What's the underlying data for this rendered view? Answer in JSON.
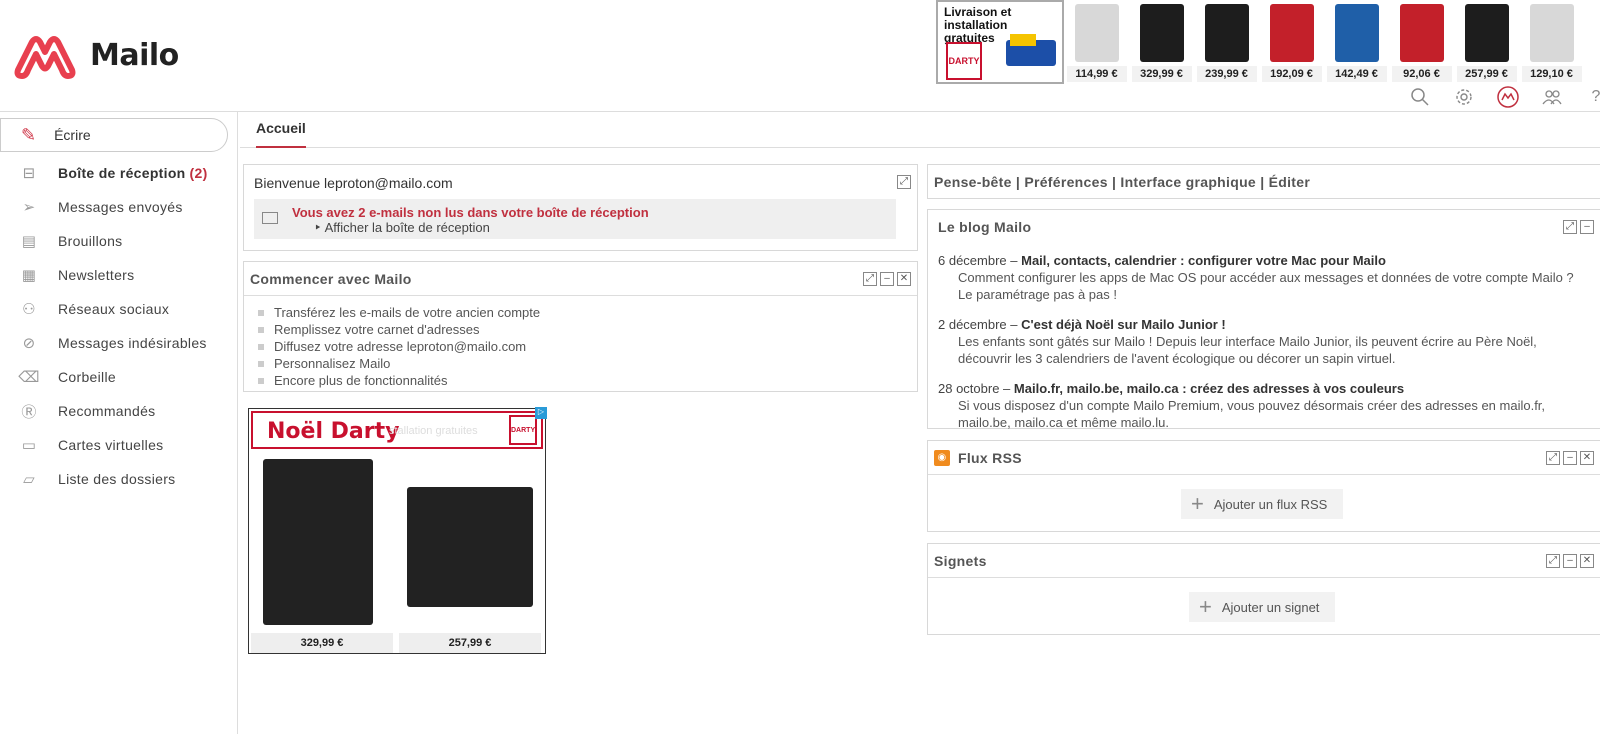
{
  "app": {
    "name": "Mailo"
  },
  "ad_banner": {
    "promo_title": "Livraison et installation gratuites",
    "promo_brand": "DARTY",
    "products": [
      {
        "price": "114,99 €",
        "color": "#d8d8d8"
      },
      {
        "price": "329,99 €",
        "color": "#1d1d1d"
      },
      {
        "price": "239,99 €",
        "color": "#1d1d1d"
      },
      {
        "price": "192,09 €",
        "color": "#c3202a"
      },
      {
        "price": "142,49 €",
        "color": "#1f5fa8"
      },
      {
        "price": "92,06 €",
        "color": "#c3202a"
      },
      {
        "price": "257,99 €",
        "color": "#1d1d1d"
      },
      {
        "price": "129,10 €",
        "color": "#d8d8d8"
      }
    ]
  },
  "top_icons": [
    "search-icon",
    "gear-icon",
    "mailo-icon",
    "contacts-icon",
    "help-icon"
  ],
  "sidebar": {
    "compose_label": "Écrire",
    "items": [
      {
        "label": "Boîte de réception",
        "count": "(2)",
        "icon": "inbox-icon"
      },
      {
        "label": "Messages envoyés",
        "icon": "send-icon"
      },
      {
        "label": "Brouillons",
        "icon": "draft-icon"
      },
      {
        "label": "Newsletters",
        "icon": "newsletter-icon"
      },
      {
        "label": "Réseaux sociaux",
        "icon": "social-icon"
      },
      {
        "label": "Messages indésirables",
        "icon": "spam-icon"
      },
      {
        "label": "Corbeille",
        "icon": "trash-icon"
      },
      {
        "label": "Recommandés",
        "icon": "registered-icon"
      },
      {
        "label": "Cartes virtuelles",
        "icon": "card-icon"
      },
      {
        "label": "Liste des dossiers",
        "icon": "folder-icon"
      }
    ]
  },
  "tabs": {
    "home": "Accueil"
  },
  "welcome": {
    "title": "Bienvenue leproton@mailo.com",
    "unread": "Vous avez 2 e-mails non lus dans votre boîte de réception",
    "show_inbox": "‣ Afficher la boîte de réception"
  },
  "start": {
    "title": "Commencer avec Mailo",
    "items": [
      "Transférez les e-mails de votre ancien compte",
      "Remplissez votre carnet d'adresses",
      "Diffusez votre adresse leproton@mailo.com",
      "Personnalisez Mailo",
      "Encore plus de fonctionnalités"
    ]
  },
  "ad_box": {
    "title": "Noël Darty",
    "faded_text": "stallation gratuites",
    "brand": "DARTY",
    "prices": [
      "329,99 €",
      "257,99 €"
    ]
  },
  "links_bar": {
    "items": [
      "Pense-bête",
      "Préférences",
      "Interface graphique",
      "Éditer"
    ],
    "separator": " | "
  },
  "blog": {
    "title": "Le blog Mailo",
    "entries": [
      {
        "date": "6 décembre",
        "headline": "Mail, contacts, calendrier : configurer votre Mac pour Mailo",
        "desc": "Comment configurer les apps de Mac OS pour accéder aux messages et données de votre compte Mailo ? Le paramétrage pas à pas !"
      },
      {
        "date": "2 décembre",
        "headline": "C'est déjà Noël sur Mailo Junior !",
        "desc": "Les enfants sont gâtés sur Mailo ! Depuis leur interface Mailo Junior, ils peuvent écrire au Père Noël, découvrir les 3 calendriers de l'avent écologique ou décorer un sapin virtuel."
      },
      {
        "date": "28 octobre",
        "headline": "Mailo.fr, mailo.be, mailo.ca : créez des adresses à vos couleurs",
        "desc": "Si vous disposez d'un compte Mailo Premium, vous pouvez désormais créer des adresses en mailo.fr, mailo.be, mailo.ca et même mailo.lu."
      }
    ],
    "dash": " – "
  },
  "rss": {
    "title": "Flux RSS",
    "add_label": "Ajouter un flux RSS"
  },
  "bookmarks": {
    "title": "Signets",
    "add_label": "Ajouter un signet"
  },
  "controls": {
    "expand": "⤢",
    "minimize": "–",
    "close": "✕"
  },
  "colors": {
    "brand": "#e8404f",
    "accent": "#c0303f"
  }
}
